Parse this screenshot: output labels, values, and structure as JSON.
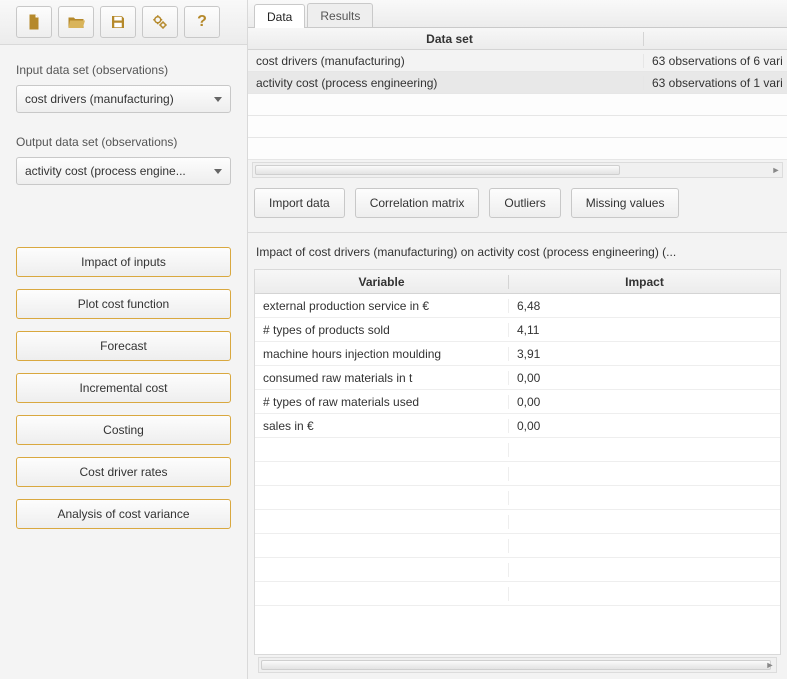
{
  "sidebar": {
    "input_label": "Input data set (observations)",
    "input_value": "cost drivers (manufacturing)",
    "output_label": "Output data set (observations)",
    "output_value": "activity cost (process engine...",
    "actions": [
      "Impact of inputs",
      "Plot cost function",
      "Forecast",
      "Incremental cost",
      "Costing",
      "Cost driver rates",
      "Analysis of cost variance"
    ]
  },
  "tabs": {
    "data": "Data",
    "results": "Results"
  },
  "dataset_grid": {
    "header_dataset": "Data set",
    "rows": [
      {
        "name": "cost drivers (manufacturing)",
        "info": "63 observations of 6 vari"
      },
      {
        "name": "activity cost (process engineering)",
        "info": "63 observations of 1 vari"
      }
    ]
  },
  "buttons": {
    "import": "Import data",
    "corr": "Correlation matrix",
    "outliers": "Outliers",
    "missing": "Missing values"
  },
  "impact": {
    "title": "Impact of cost drivers (manufacturing) on activity cost (process engineering) (...",
    "header_var": "Variable",
    "header_imp": "Impact",
    "rows": [
      {
        "v": "external production service in €",
        "i": "6,48"
      },
      {
        "v": "# types of products sold",
        "i": "4,11"
      },
      {
        "v": "machine hours injection moulding",
        "i": "3,91"
      },
      {
        "v": "consumed raw materials in t",
        "i": "0,00"
      },
      {
        "v": "# types of raw materials used",
        "i": "0,00"
      },
      {
        "v": "sales in €",
        "i": "0,00"
      }
    ]
  }
}
